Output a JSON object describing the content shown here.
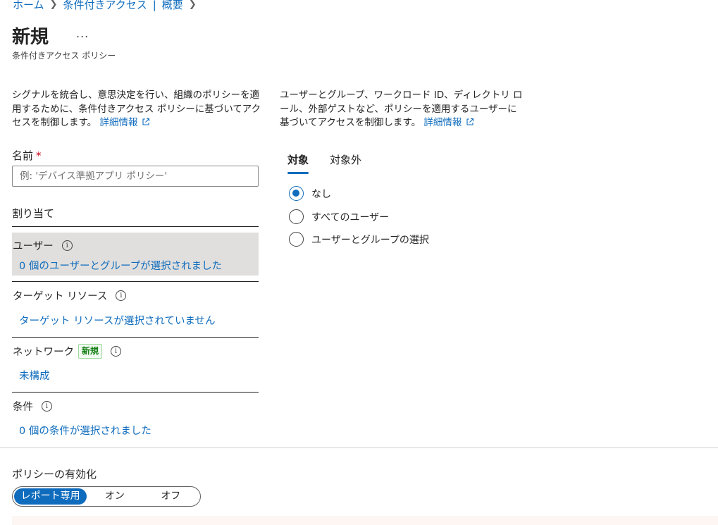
{
  "breadcrumb": {
    "home": "ホーム",
    "parent": "条件付きアクセス",
    "separator": "|",
    "current": "概要"
  },
  "header": {
    "title": "新規",
    "more": "...",
    "subtitle": "条件付きアクセス ポリシー"
  },
  "description_left": {
    "text": "シグナルを統合し、意思決定を行い、組織のポリシーを適用するために、条件付きアクセス ポリシーに基づいてアクセスを制御します。",
    "link": "詳細情報"
  },
  "description_right": {
    "text": "ユーザーとグループ、ワークロード ID、ディレクトリ ロール、外部ゲストなど、ポリシーを適用するユーザーに基づいてアクセスを制御します。",
    "link": "詳細情報"
  },
  "name_field": {
    "label": "名前",
    "required_mark": "*",
    "value": "",
    "placeholder": "例: 'デバイス準拠アプリ ポリシー'"
  },
  "assignments": {
    "label": "割り当て",
    "users": {
      "label": "ユーザー",
      "summary": "0 個のユーザーとグループが選択されました"
    },
    "target_resources": {
      "label": "ターゲット リソース",
      "summary": "ターゲット リソースが選択されていません"
    },
    "network": {
      "label": "ネットワーク",
      "badge": "新規",
      "summary": "未構成"
    },
    "conditions": {
      "label": "条件",
      "summary": "0 個の条件が選択されました"
    }
  },
  "user_tabs": {
    "include": "対象",
    "exclude": "対象外",
    "active": "include"
  },
  "include_options": [
    {
      "label": "なし",
      "checked": true
    },
    {
      "label": "すべてのユーザー",
      "checked": false
    },
    {
      "label": "ユーザーとグループの選択",
      "checked": false
    }
  ],
  "enable_policy": {
    "label": "ポリシーの有効化",
    "options": [
      "レポート専用",
      "オン",
      "オフ"
    ],
    "selected": "レポート専用"
  },
  "colors": {
    "accent": "#0f6cbd",
    "selected_section_bg": "#e1dfdd",
    "badge_green": "#107c10",
    "required_red": "#c50f1f"
  }
}
